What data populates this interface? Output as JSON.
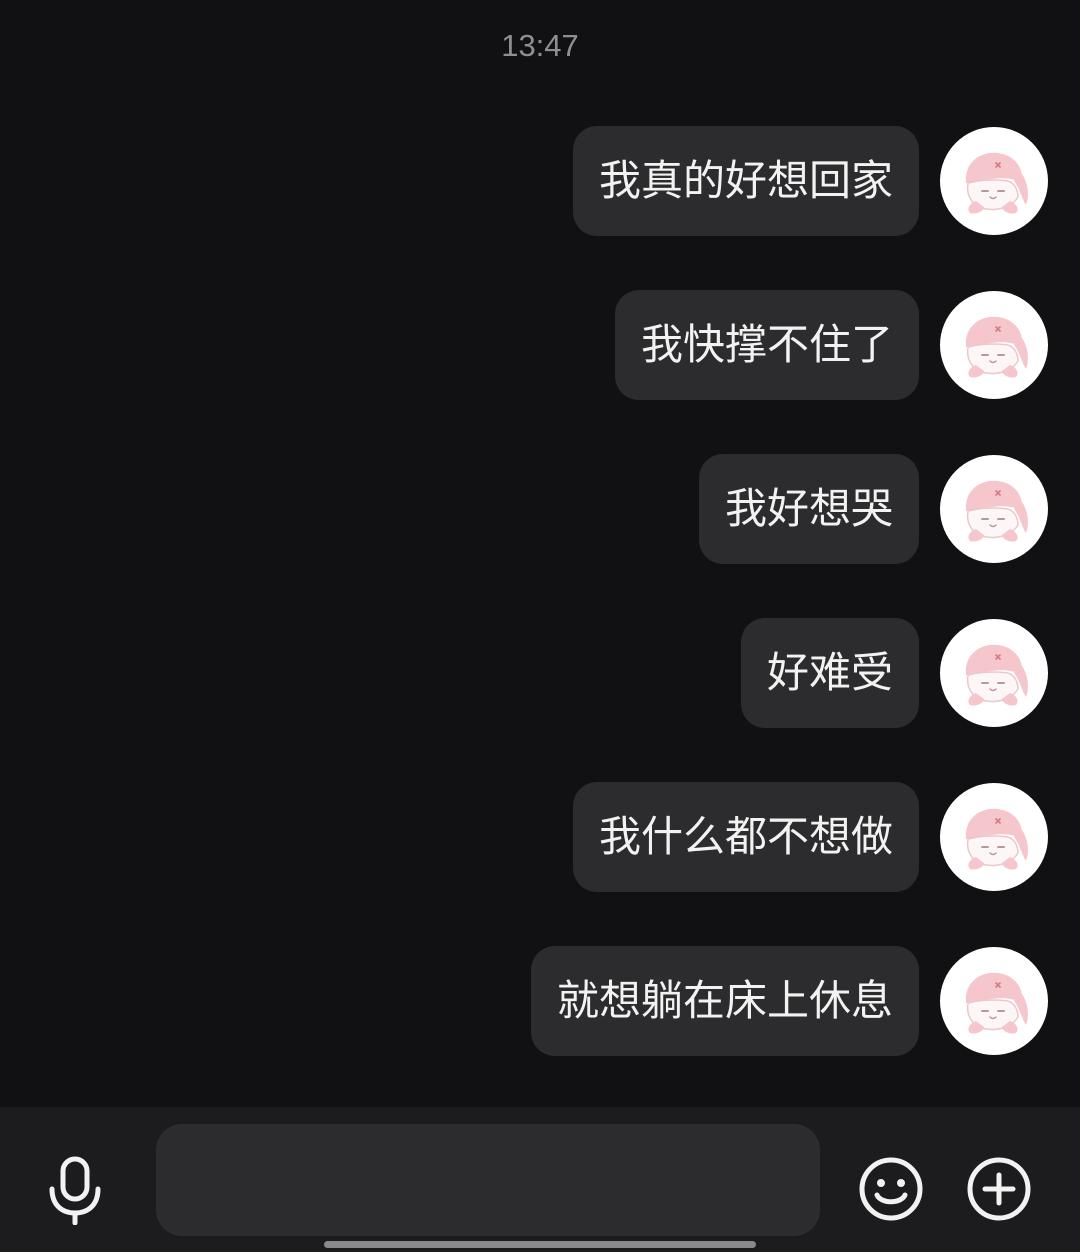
{
  "chat": {
    "timestamp": "13:47",
    "messages": [
      {
        "text": "我真的好想回家",
        "sender": "me"
      },
      {
        "text": "我快撑不住了",
        "sender": "me"
      },
      {
        "text": "我好想哭",
        "sender": "me"
      },
      {
        "text": "好难受",
        "sender": "me"
      },
      {
        "text": "我什么都不想做",
        "sender": "me"
      },
      {
        "text": "就想躺在床上休息",
        "sender": "me"
      }
    ],
    "avatar_icon": "pink-bunny-avatar-icon"
  },
  "input_bar": {
    "mic_icon": "microphone-icon",
    "input_value": "",
    "emoji_icon": "smiley-face-icon",
    "plus_icon": "plus-circle-icon"
  },
  "colors": {
    "background": "#111113",
    "bubble": "#2c2c2e",
    "bubble_text": "#f2f2f2",
    "timestamp": "#8e8e93",
    "input_bar": "#1c1c1e",
    "avatar_bg": "#ffffff",
    "avatar_accent": "#f5c6cc"
  }
}
